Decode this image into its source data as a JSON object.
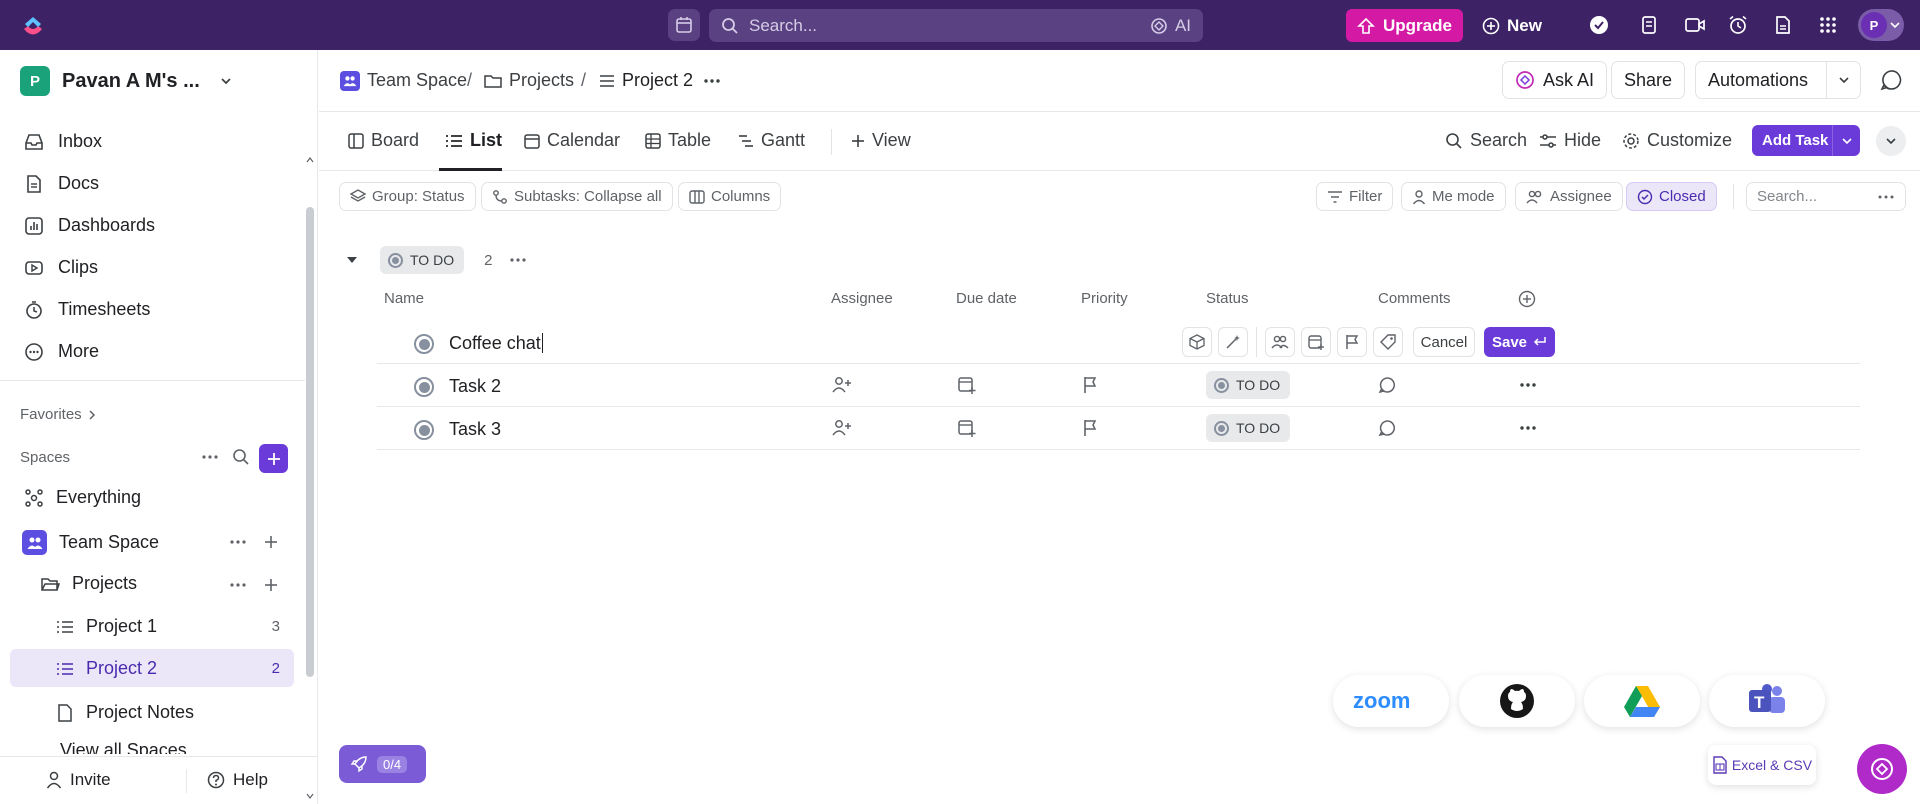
{
  "topbar": {
    "search_placeholder": "Search...",
    "ai_label": "AI",
    "upgrade_label": "Upgrade",
    "new_label": "New",
    "avatar_initial": "P"
  },
  "sidebar": {
    "workspace_initial": "P",
    "workspace_name": "Pavan A M's ...",
    "nav": [
      {
        "label": "Inbox",
        "icon": "inbox-icon"
      },
      {
        "label": "Docs",
        "icon": "docs-icon"
      },
      {
        "label": "Dashboards",
        "icon": "dashboards-icon"
      },
      {
        "label": "Clips",
        "icon": "clips-icon"
      },
      {
        "label": "Timesheets",
        "icon": "timesheets-icon"
      },
      {
        "label": "More",
        "icon": "more-icon"
      }
    ],
    "favorites_label": "Favorites",
    "spaces_label": "Spaces",
    "everything_label": "Everything",
    "team_space_label": "Team Space",
    "projects_folder_label": "Projects",
    "lists": [
      {
        "label": "Project 1",
        "count": "3"
      },
      {
        "label": "Project 2",
        "count": "2"
      },
      {
        "label": "Project Notes",
        "count": ""
      }
    ],
    "view_all_label": "View all Spaces",
    "invite_label": "Invite",
    "help_label": "Help"
  },
  "header": {
    "breadcrumb": [
      "Team Space",
      "Projects",
      "Project 2"
    ],
    "ask_ai_label": "Ask AI",
    "share_label": "Share",
    "automations_label": "Automations"
  },
  "views": {
    "tabs": [
      "Board",
      "List",
      "Calendar",
      "Table",
      "Gantt"
    ],
    "active_tab": "List",
    "add_view_label": "View",
    "search_label": "Search",
    "hide_label": "Hide",
    "customize_label": "Customize",
    "add_task_label": "Add Task"
  },
  "filters": {
    "group_label": "Group: Status",
    "subtasks_label": "Subtasks: Collapse all",
    "columns_label": "Columns",
    "filter_label": "Filter",
    "me_mode_label": "Me mode",
    "assignee_label": "Assignee",
    "closed_label": "Closed",
    "search_placeholder": "Search..."
  },
  "group": {
    "status_label": "TO DO",
    "count": "2"
  },
  "columns": [
    "Name",
    "Assignee",
    "Due date",
    "Priority",
    "Status",
    "Comments"
  ],
  "new_task": {
    "value": "Coffee chat",
    "cancel_label": "Cancel",
    "save_label": "Save"
  },
  "tasks": [
    {
      "name": "Task 2",
      "status": "TO DO"
    },
    {
      "name": "Task 3",
      "status": "TO DO"
    }
  ],
  "bottom": {
    "rocket_count": "0/4",
    "excel_label": "Excel & CSV",
    "integrations": [
      "zoom",
      "github",
      "google-drive",
      "teams"
    ]
  }
}
